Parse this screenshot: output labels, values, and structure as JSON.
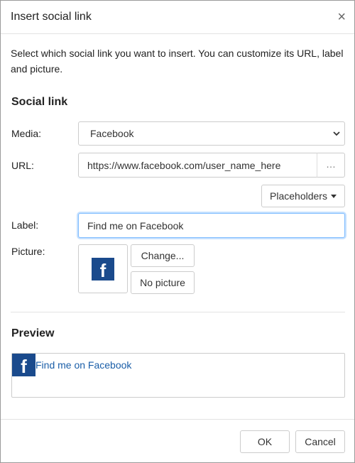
{
  "dialog": {
    "title": "Insert social link",
    "close_glyph": "×",
    "intro": "Select which social link you want to insert. You can customize its URL, label and picture."
  },
  "social_link": {
    "heading": "Social link",
    "media_label": "Media:",
    "media_value": "Facebook",
    "url_label": "URL:",
    "url_value": "https://www.facebook.com/user_name_here",
    "url_more": "…",
    "placeholders_button": "Placeholders",
    "label_label": "Label:",
    "label_value": "Find me on Facebook",
    "picture_label": "Picture:",
    "picture_icon_glyph": "f",
    "change_button": "Change...",
    "no_picture_button": "No picture"
  },
  "preview": {
    "heading": "Preview",
    "icon_glyph": "f",
    "link_text": "Find me on Facebook"
  },
  "footer": {
    "ok_button": "OK",
    "cancel_button": "Cancel"
  },
  "colors": {
    "facebook_blue": "#1a4a8c",
    "link_blue": "#1a5ea8",
    "focus_border": "#80bdff"
  },
  "icons": {
    "close": "close-icon",
    "select_chevron": "chevron-down-icon",
    "dropdown_caret": "caret-down-icon",
    "facebook": "facebook-icon"
  }
}
